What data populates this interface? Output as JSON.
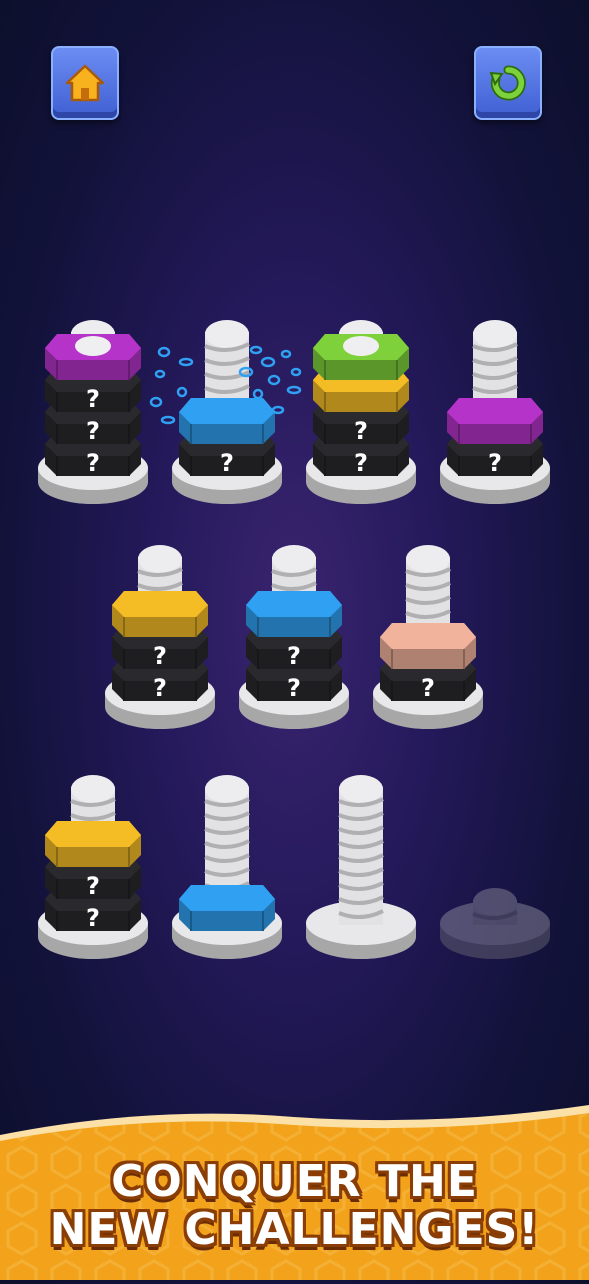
{
  "header": {
    "home_icon": "home-icon",
    "restart_icon": "restart-icon"
  },
  "banner": {
    "line1": "CONQUER THE",
    "line2": "NEW CHALLENGES!"
  },
  "colors": {
    "purple": "#b533c9",
    "blue": "#2fa0f2",
    "green": "#7ed13a",
    "yellow": "#f5bd25",
    "peach": "#f2b39c",
    "black": "#2a2a2e",
    "banner": "#f2a31b"
  },
  "mystery_label": "?",
  "screws": [
    {
      "id": "screw-1",
      "nuts": [
        "black",
        "black",
        "black",
        "purple"
      ]
    },
    {
      "id": "screw-2",
      "nuts": [
        "black",
        "blue"
      ]
    },
    {
      "id": "screw-3",
      "nuts": [
        "black",
        "black",
        "yellow",
        "green"
      ]
    },
    {
      "id": "screw-4",
      "nuts": [
        "black",
        "purple"
      ]
    },
    {
      "id": "screw-5",
      "nuts": [
        "black",
        "black",
        "yellow"
      ]
    },
    {
      "id": "screw-6",
      "nuts": [
        "black",
        "black",
        "blue"
      ]
    },
    {
      "id": "screw-7",
      "nuts": [
        "black",
        "peach"
      ]
    },
    {
      "id": "screw-8",
      "nuts": [
        "black",
        "black",
        "yellow"
      ]
    },
    {
      "id": "screw-9",
      "nuts": [
        "blue"
      ]
    },
    {
      "id": "screw-10",
      "nuts": []
    },
    {
      "id": "screw-11",
      "nuts": [],
      "locked": true
    }
  ]
}
